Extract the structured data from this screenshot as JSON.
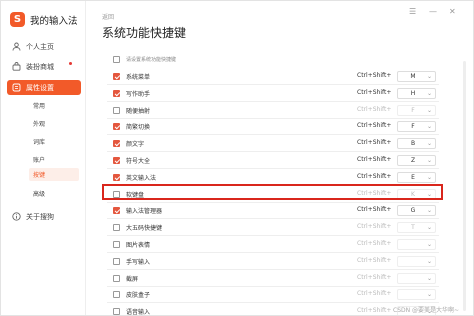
{
  "app": {
    "name": "我的输入法"
  },
  "window_controls": [
    "☰",
    "—",
    "✕"
  ],
  "sidebar": {
    "items": [
      {
        "label": "个人主页",
        "icon": "user-icon"
      },
      {
        "label": "装扮商城",
        "icon": "shop-icon"
      },
      {
        "label": "属性设置",
        "icon": "settings-icon",
        "active": true
      }
    ],
    "sub_items": [
      {
        "label": "常用"
      },
      {
        "label": "外观"
      },
      {
        "label": "词库"
      },
      {
        "label": "账户"
      },
      {
        "label": "按键",
        "active": true
      },
      {
        "label": "高级"
      }
    ],
    "about": {
      "label": "关于搜狗",
      "icon": "info-icon"
    }
  },
  "header": {
    "back": "返回",
    "title": "系统功能快捷键"
  },
  "enable_row": {
    "label": "请设置系统功能快捷键",
    "checked": false
  },
  "shortcuts": [
    {
      "name": "系统菜单",
      "checked": true,
      "combo": "Ctrl+Shift+",
      "key": "M",
      "dim": false
    },
    {
      "name": "写作助手",
      "checked": true,
      "combo": "Ctrl+Shift+",
      "key": "H",
      "dim": false
    },
    {
      "name": "随便抽射",
      "checked": false,
      "combo": "Ctrl+Shift+",
      "key": "F",
      "dim": true
    },
    {
      "name": "简繁切换",
      "checked": true,
      "combo": "Ctrl+Shift+",
      "key": "F",
      "dim": false
    },
    {
      "name": "颜文字",
      "checked": true,
      "combo": "Ctrl+Shift+",
      "key": "B",
      "dim": false
    },
    {
      "name": "符号大全",
      "checked": true,
      "combo": "Ctrl+Shift+",
      "key": "Z",
      "dim": false
    },
    {
      "name": "英文输入法",
      "checked": true,
      "combo": "Ctrl+Shift+",
      "key": "E",
      "dim": false
    },
    {
      "name": "软键盘",
      "checked": false,
      "combo": "Ctrl+Shift+",
      "key": "K",
      "dim": true
    },
    {
      "name": "输入法管理器",
      "checked": true,
      "combo": "Ctrl+Shift+",
      "key": "G",
      "dim": false
    },
    {
      "name": "大五码快捷键",
      "checked": false,
      "combo": "Ctrl+Shift+",
      "key": "T",
      "dim": true
    },
    {
      "name": "图片表情",
      "checked": false,
      "combo": "Ctrl+Shift+",
      "key": "",
      "dim": true
    },
    {
      "name": "手写输入",
      "checked": false,
      "combo": "Ctrl+Shift+",
      "key": "",
      "dim": true
    },
    {
      "name": "截屏",
      "checked": false,
      "combo": "Ctrl+Shift+",
      "key": "",
      "dim": true
    },
    {
      "name": "皮肤盒子",
      "checked": false,
      "combo": "Ctrl+Shift+",
      "key": "",
      "dim": true
    },
    {
      "name": "语音输入",
      "checked": false,
      "combo": "Ctrl+Shift+",
      "key": "",
      "dim": true
    }
  ],
  "colors": {
    "accent": "#f25a29",
    "checkbox": "#e4573e",
    "highlight": "#d9261c"
  },
  "watermark": "CSDN @要美是大华啊~"
}
